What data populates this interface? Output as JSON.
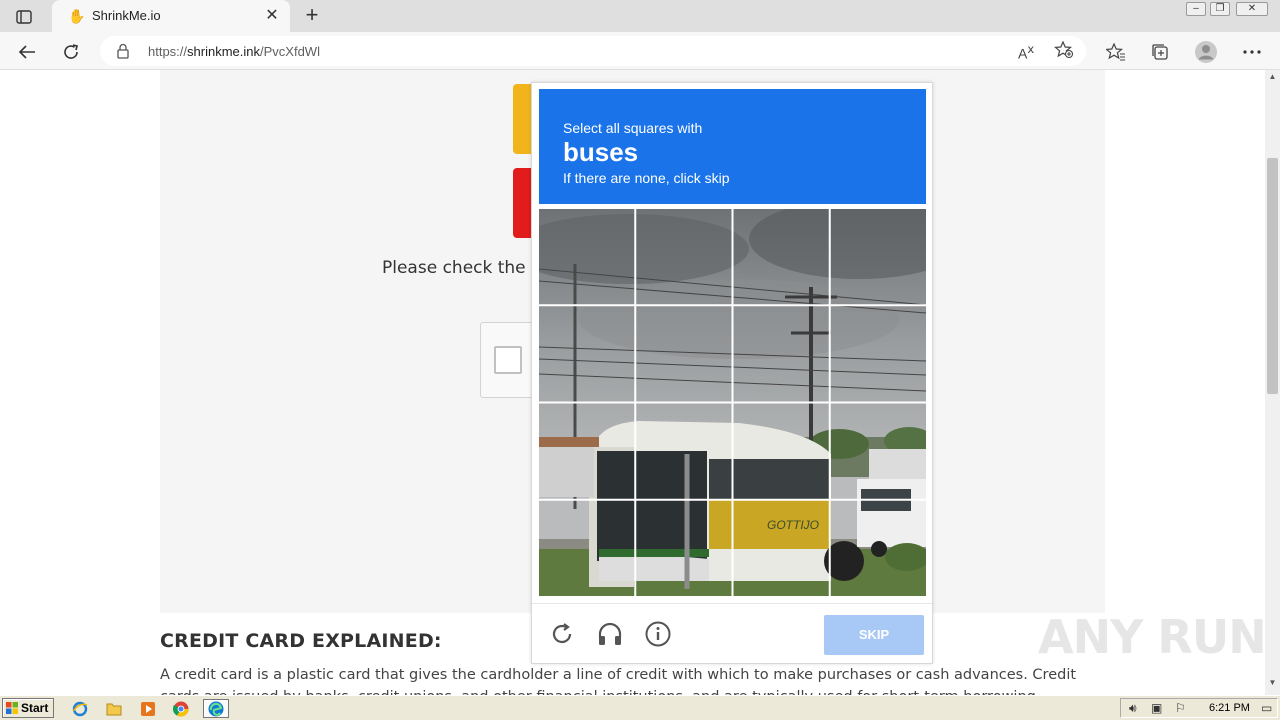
{
  "browser": {
    "tab": {
      "title": "ShrinkMe.io",
      "favicon": "hand-icon"
    },
    "address": {
      "url_prefix": "https://",
      "url_host": "shrinkme.ink",
      "url_path": "/PvcXfdWl"
    },
    "toolbar_icons": [
      "back-icon",
      "reload-icon",
      "read-aloud-icon",
      "add-favorite-icon",
      "favorites-icon",
      "collections-icon",
      "profile-icon",
      "more-icon"
    ]
  },
  "page": {
    "instruction": "Please check the ca",
    "section_heading": "CREDIT CARD EXPLAINED:",
    "article_text": "A credit card is a plastic card that gives the cardholder a line of credit with which to make purchases or cash advances. Credit cards are issued by banks, credit unions, and other financial institutions, and are typically used for short-term borrowing."
  },
  "challenge": {
    "prompt_line1": "Select all squares with",
    "prompt_keyword": "buses",
    "prompt_line2": "If there are none, click skip",
    "skip_label": "SKIP",
    "grid_size": 4,
    "accent_color": "#1a73e8",
    "skip_color": "#a8c8f6"
  },
  "watermark": {
    "text": "ANY RUN"
  },
  "taskbar": {
    "start_label": "Start",
    "apps": [
      "ie-icon",
      "folder-icon",
      "media-player-icon",
      "chrome-icon",
      "edge-icon"
    ],
    "clock": "6:21 PM"
  }
}
